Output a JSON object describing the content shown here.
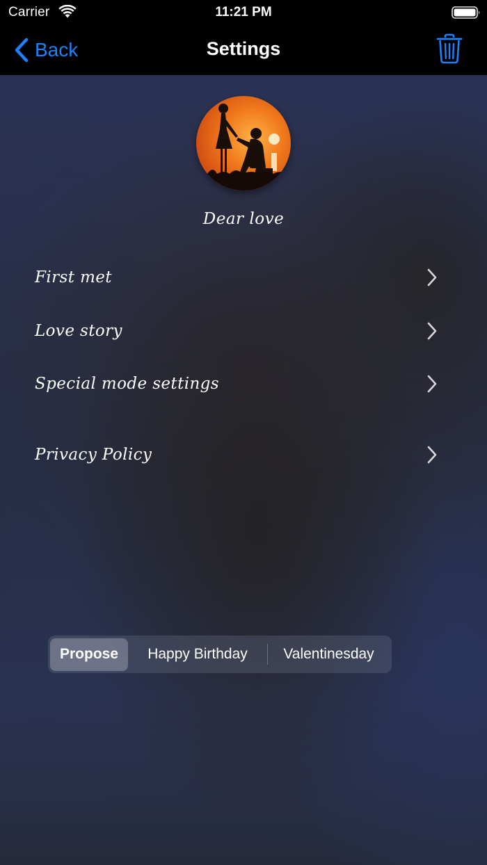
{
  "status_bar": {
    "carrier": "Carrier",
    "time": "11:21 PM",
    "icons": [
      "wifi-icon",
      "battery-icon"
    ]
  },
  "nav": {
    "back_label": "Back",
    "title": "Settings",
    "accent_color": "#1a82fb",
    "right_icon": "trash-icon"
  },
  "profile": {
    "avatar_icon": "couple-proposal-silhouette",
    "caption": "Dear love"
  },
  "settings_rows": [
    {
      "label": "First met",
      "icon": "chevron-right-icon"
    },
    {
      "label": "Love story",
      "icon": "chevron-right-icon"
    },
    {
      "label": "Special mode settings",
      "icon": "chevron-right-icon"
    },
    {
      "label": "Privacy Policy",
      "icon": "chevron-right-icon"
    }
  ],
  "mode_selector": {
    "options": [
      "Propose",
      "Happy Birthday",
      "Valentinesday"
    ],
    "selected": "Propose"
  }
}
